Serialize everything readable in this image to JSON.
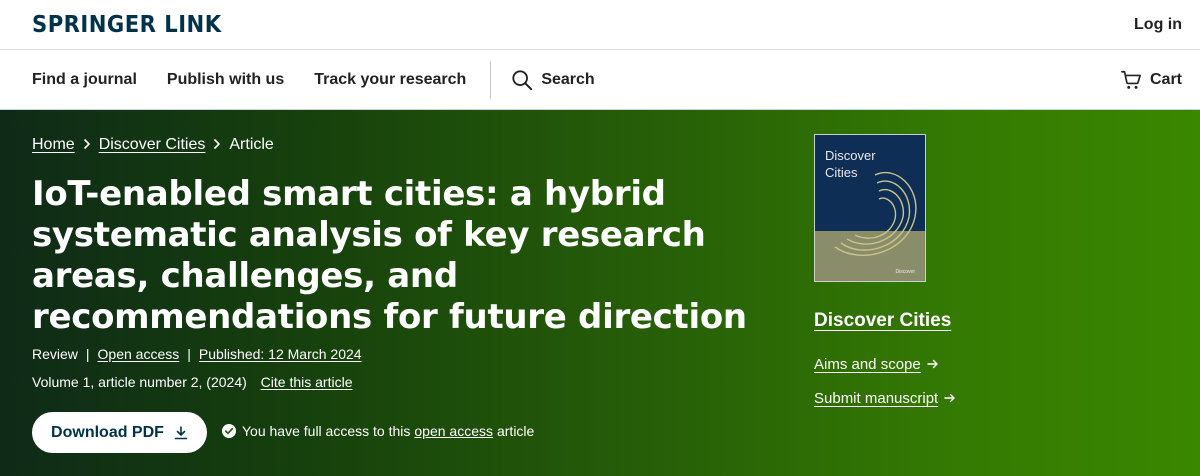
{
  "header": {
    "logo_text": "Springer Link",
    "login_label": "Log in"
  },
  "nav": {
    "items": [
      {
        "label": "Find a journal"
      },
      {
        "label": "Publish with us"
      },
      {
        "label": "Track your research"
      }
    ],
    "search_label": "Search",
    "cart_label": "Cart"
  },
  "breadcrumb": {
    "home": "Home",
    "journal": "Discover Cities",
    "current": "Article"
  },
  "article": {
    "title": "IoT-enabled smart cities: a hybrid systematic analysis of key research areas, challenges, and recommendations for future direction",
    "type": "Review",
    "access": "Open access",
    "published": "Published: 12 March 2024",
    "volume": "Volume 1, article number 2, (2024)",
    "cite_label": "Cite this article",
    "download_label": "Download PDF",
    "access_text_before": "You have full access to this",
    "access_link": "open access",
    "access_text_after": "article"
  },
  "journal": {
    "cover_title_line1": "Discover",
    "cover_title_line2": "Cities",
    "cover_publisher": "Discover",
    "name": "Discover Cities",
    "aims_label": "Aims and scope",
    "submit_label": "Submit manuscript"
  },
  "colors": {
    "brand_navy": "#01324b",
    "hero_start": "#0f2a18",
    "hero_end": "#3a8700"
  },
  "icons": {
    "search": "search-icon",
    "cart": "cart-icon",
    "download": "download-icon",
    "check": "check-circle-icon",
    "chevron": "chevron-right-icon",
    "arrow": "arrow-right-icon"
  }
}
